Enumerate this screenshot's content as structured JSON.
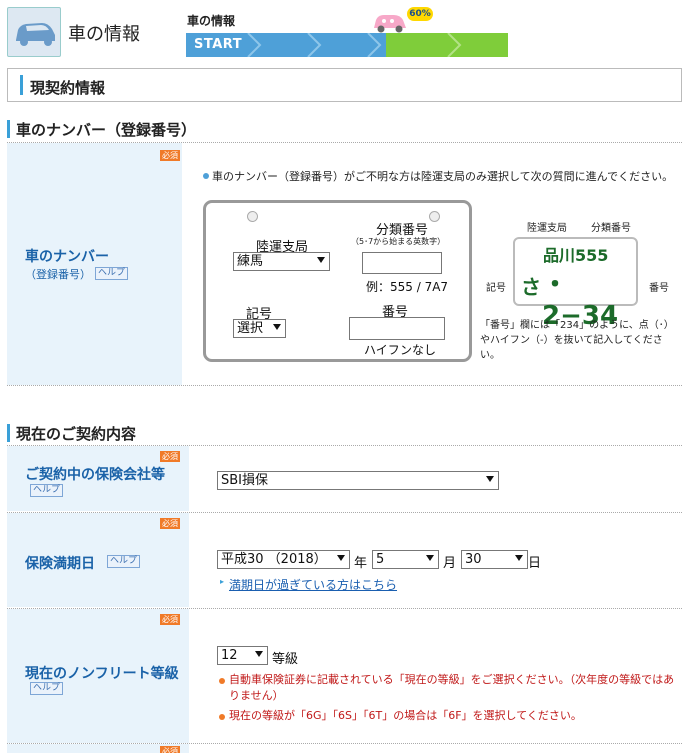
{
  "header": {
    "title": "車の情報",
    "progress_label": "車の情報",
    "progress_start": "START",
    "progress_percent": "60%",
    "progress_value": 0.6
  },
  "section_box": {
    "title": "現契約情報"
  },
  "plate_section": {
    "heading": "車のナンバー（登録番号）",
    "required": "必須",
    "label_title": "車のナンバー",
    "label_sub": "（登録番号）",
    "help": "ヘルプ",
    "note": "車のナンバー（登録番号）がご不明な方は陸運支局のみ選択して次の質問に進んでください。",
    "rikuun_label": "陸運支局",
    "rikuun_value": "練馬",
    "bunrui_label": "分類番号",
    "bunrui_sub": "（5･7から始まる英数字）",
    "bunrui_example": "例：555 / 7A7",
    "kigo_label": "記号",
    "kigo_value": "選択",
    "bango_label": "番号",
    "bango_note": "ハイフンなし",
    "sample": {
      "label_rikuun": "陸運支局",
      "label_bunrui": "分類番号",
      "label_kigo": "記号",
      "label_bango": "番号",
      "top_line": "品川555",
      "kana": "さ",
      "number": "・2−34"
    },
    "sample_note": "「番号」欄には「234」のように、点（･）やハイフン（-）を抜いて記入してください。"
  },
  "contract_section": {
    "heading": "現在のご契約内容",
    "insurer": {
      "required": "必須",
      "label": "ご契約中の保険会社等",
      "help": "ヘルプ",
      "value": "SBI損保"
    },
    "expiry": {
      "required": "必須",
      "label": "保険満期日",
      "help": "ヘルプ",
      "era_value": "平成30 （2018）",
      "year_suffix": "年",
      "month_value": "5",
      "month_suffix": "月",
      "day_value": "30",
      "day_suffix": "日",
      "link": "満期日が過ぎている方はこちら"
    },
    "grade": {
      "required": "必須",
      "label": "現在のノンフリート等級",
      "help": "ヘルプ",
      "value": "12",
      "suffix": "等級",
      "note1": "自動車保険証券に記載されている「現在の等級」をご選択ください。（次年度の等級ではありません）",
      "note2": "現在の等級が「6G」「6S」「6T」の場合は「6F」を選択してください。"
    },
    "next_required": "必須"
  },
  "colors": {
    "accent": "#3aa0d8",
    "progress_done": "#4ea0d8",
    "progress_rest": "#7fcd3a",
    "required": "#f07a28",
    "label_bg": "#e8f3fb",
    "plate_green": "#1c6b2a"
  }
}
